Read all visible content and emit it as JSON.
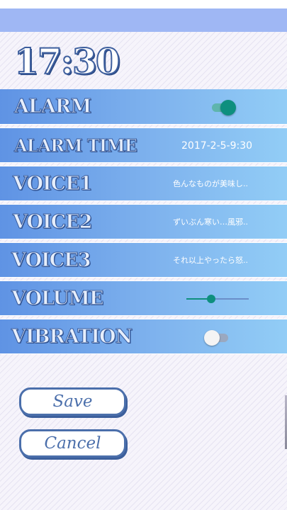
{
  "clock": {
    "time": "17:30"
  },
  "settings": [
    {
      "label": "ALARM",
      "kind": "switch",
      "on": true
    },
    {
      "label": "ALARM TIME",
      "kind": "text",
      "value": "2017-2-5-9:30"
    },
    {
      "label": "VOICE1",
      "kind": "text",
      "value": "色んなものが美味し.."
    },
    {
      "label": "VOICE2",
      "kind": "text",
      "value": "ずいぶん寒い…風邪.."
    },
    {
      "label": "VOICE3",
      "kind": "text",
      "value": "それ以上やったら怒.."
    },
    {
      "label": "VOLUME",
      "kind": "slider",
      "level": 0.4
    },
    {
      "label": "VIBRATION",
      "kind": "switch",
      "on": false
    }
  ],
  "buttons": {
    "save": "Save",
    "cancel": "Cancel"
  },
  "colors": {
    "accent": "#0e8f7e",
    "row": "#7fb3ee",
    "outline": "#4b6fab"
  }
}
